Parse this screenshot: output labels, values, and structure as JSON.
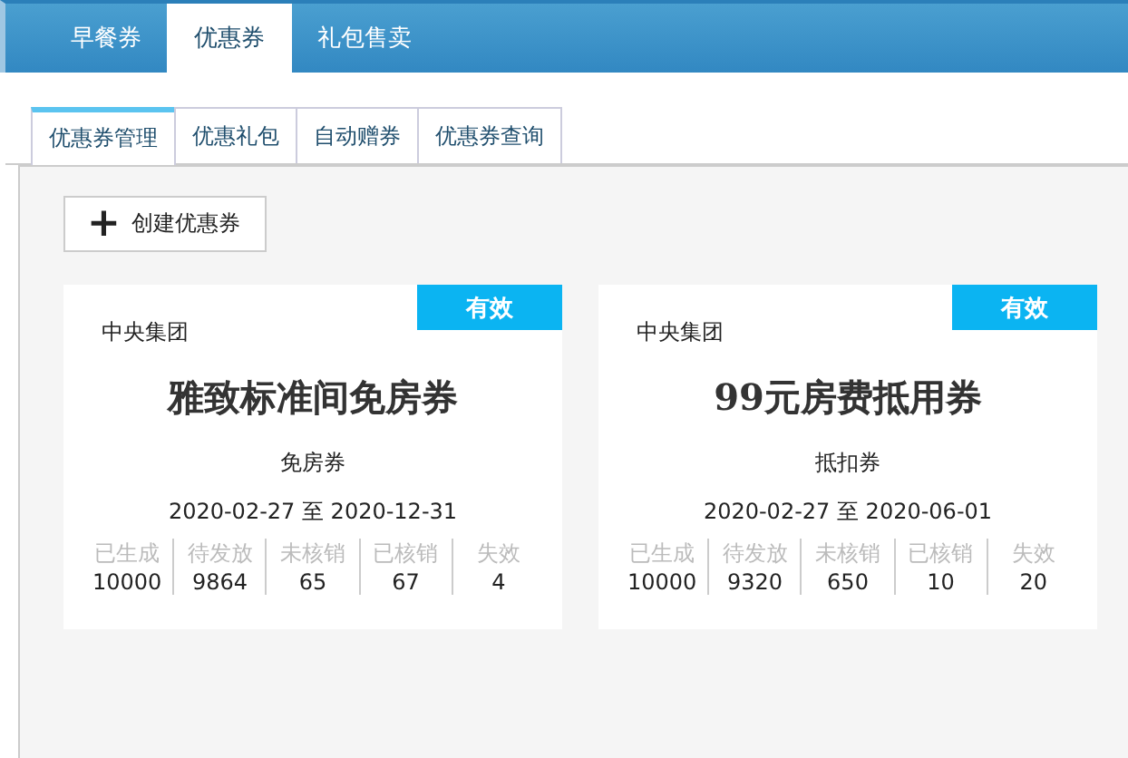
{
  "top_tabs": [
    {
      "label": "早餐券",
      "selected": false
    },
    {
      "label": "优惠券",
      "selected": true
    },
    {
      "label": "礼包售卖",
      "selected": false
    }
  ],
  "sub_tabs": [
    {
      "label": "优惠券管理",
      "selected": true
    },
    {
      "label": "优惠礼包",
      "selected": false
    },
    {
      "label": "自动赠券",
      "selected": false
    },
    {
      "label": "优惠券查询",
      "selected": false
    }
  ],
  "create_button": {
    "icon": "+",
    "label": "创建优惠券"
  },
  "coupons": [
    {
      "status": "有效",
      "issuer": "中央集团",
      "title": "雅致标准间免房券",
      "type": "免房券",
      "period": "2020-02-27 至 2020-12-31",
      "stats": [
        {
          "label": "已生成",
          "value": "10000"
        },
        {
          "label": "待发放",
          "value": "9864"
        },
        {
          "label": "未核销",
          "value": "65"
        },
        {
          "label": "已核销",
          "value": "67"
        },
        {
          "label": "失效",
          "value": "4"
        }
      ]
    },
    {
      "status": "有效",
      "issuer": "中央集团",
      "title": "**99**元房费抵用券",
      "type": "抵扣券",
      "period": "2020-02-27 至 2020-06-01",
      "stats": [
        {
          "label": "已生成",
          "value": "10000"
        },
        {
          "label": "待发放",
          "value": "9320"
        },
        {
          "label": "未核销",
          "value": "650"
        },
        {
          "label": "已核销",
          "value": "10"
        },
        {
          "label": "失效",
          "value": "20"
        }
      ]
    }
  ]
}
